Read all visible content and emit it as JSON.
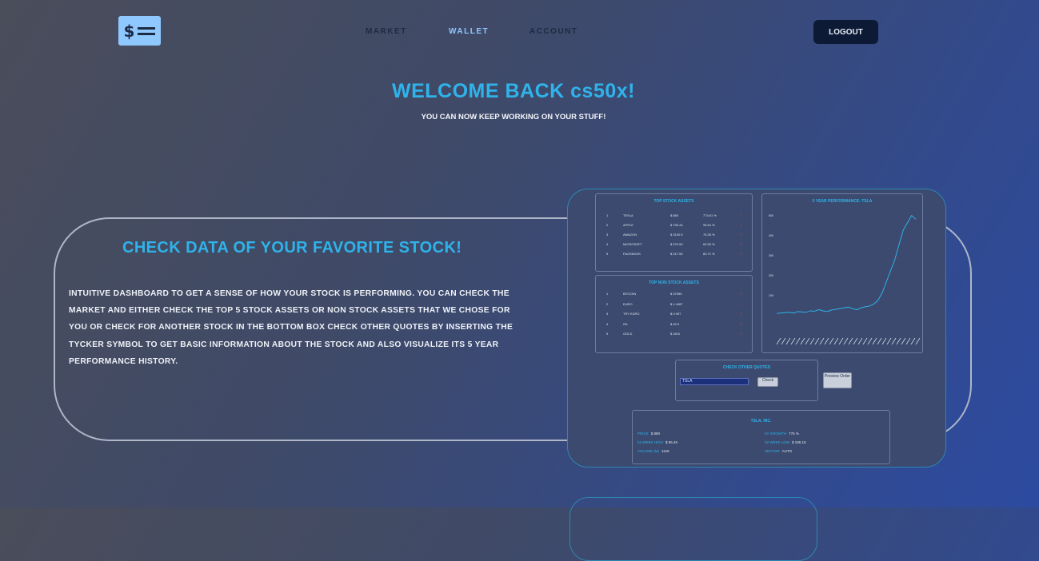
{
  "header": {
    "logo_symbol": "$",
    "nav": {
      "market": "MARKET",
      "wallet": "WALLET",
      "account": "ACCOUNT"
    },
    "logout_label": "LOGOUT"
  },
  "hero": {
    "title": "WELCOME BACK cs50x!",
    "subtitle": "YOU CAN NOW KEEP WORKING ON YOUR STUFF!"
  },
  "feature": {
    "title": "CHECK DATA OF YOUR FAVORITE STOCK!",
    "text": "INTUITIVE DASHBOARD TO GET A SENSE OF HOW YOUR STOCK IS PERFORMING. YOU CAN CHECK THE MARKET AND EITHER CHECK THE TOP 5 STOCK ASSETS OR NON STOCK ASSETS THAT WE CHOSE FOR YOU OR CHECK FOR ANOTHER STOCK IN THE BOTTOM BOX CHECK OTHER QUOTES BY INSERTING THE TYCKER SYMBOL TO GET BASIC INFORMATION ABOUT THE STOCK AND ALSO VISUALIZE ITS 5 YEAR PERFORMANCE HISTORY."
  },
  "preview": {
    "top_stock_title": "TOP STOCK ASSETS",
    "top_stock_rows": [
      {
        "n": "1",
        "name": "TESLA",
        "price": "$ 880",
        "pct": "774.61 %"
      },
      {
        "n": "2",
        "name": "APPLE",
        "price": "$ 790.44",
        "pct": "95.54 %"
      },
      {
        "n": "3",
        "name": "AMAZON",
        "price": "$ 3100.5",
        "pct": "75.35 %"
      },
      {
        "n": "4",
        "name": "MICROSOFT",
        "price": "$ 270.50",
        "pct": "63.59 %"
      },
      {
        "n": "5",
        "name": "FACEBOOK",
        "price": "$ 217.50",
        "pct": "60.71 %"
      }
    ],
    "top_nonstock_title": "TOP NON STOCK ASSETS",
    "top_nonstock_rows": [
      {
        "n": "1",
        "name": "BITCOIN",
        "price": "$ 37590"
      },
      {
        "n": "2",
        "name": "EURO",
        "price": "$ 1.1887"
      },
      {
        "n": "3",
        "name": "TRY EURO",
        "price": "$ 0.997"
      },
      {
        "n": "4",
        "name": "OIL",
        "price": "$ 45.9"
      },
      {
        "n": "5",
        "name": "GOLD",
        "price": "$ 1810"
      }
    ],
    "chart_title": "5 YEAR PERFORMANCE: TSLA",
    "quote_title": "CHECK OTHER QUOTES",
    "quote_input": "TSLA",
    "check_label": "Check",
    "preview_order_label": "Preview Order",
    "info_title": "TSLA, INC.",
    "info_left": [
      {
        "k": "PRICE",
        "v": "$ 880"
      },
      {
        "k": "52 WEEK HIGH",
        "v": "$ 95.45"
      },
      {
        "k": "VOLUME (M)",
        "v": "1125"
      }
    ],
    "info_right": [
      {
        "k": "5Y GROWTH",
        "v": "775 %"
      },
      {
        "k": "52 WEEK LOW",
        "v": "$ 186.15"
      },
      {
        "k": "SECTOR",
        "v": "AUTO"
      }
    ]
  },
  "chart_data": {
    "type": "line",
    "title": "5 YEAR PERFORMANCE: TSLA",
    "ytick_labels": [
      "500",
      "400",
      "300",
      "200",
      "100"
    ],
    "values": [
      45,
      46,
      47,
      48,
      46,
      50,
      49,
      48,
      52,
      51,
      55,
      52,
      50,
      54,
      56,
      58,
      60,
      62,
      58,
      55,
      60,
      63,
      65,
      70,
      80,
      100,
      130,
      160,
      190,
      230,
      270,
      290,
      310,
      300
    ]
  },
  "colors": {
    "accent": "#2fb3ea",
    "logo_bg": "#8fc7ff",
    "logout_bg": "#0c1a36"
  }
}
